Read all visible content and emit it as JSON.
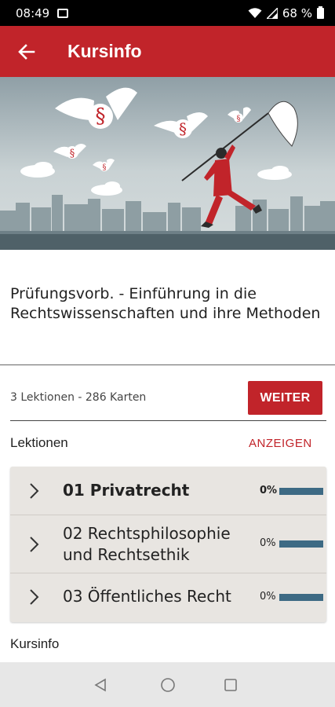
{
  "status_bar": {
    "time": "08:49",
    "battery": "68 %"
  },
  "app_bar": {
    "title": "Kursinfo",
    "back_icon": "arrow-back-icon"
  },
  "course": {
    "title": "Prüfungsvorb. - Einführung in die Rechtswissenschaften und ihre Methoden",
    "meta": "3 Lektionen - 286 Karten",
    "continue_label": "WEITER"
  },
  "lessons_section": {
    "label": "Lektionen",
    "show_label": "ANZEIGEN",
    "items": [
      {
        "name": "01 Privatrecht",
        "progress_label": "0%",
        "progress": 0,
        "bold": true
      },
      {
        "name": "02 Rechtsphilosophie und Rechtsethik",
        "progress_label": "0%",
        "progress": 0,
        "bold": false
      },
      {
        "name": "03 Öffentliches Recht",
        "progress_label": "0%",
        "progress": 0,
        "bold": false
      }
    ]
  },
  "kursinfo_section": {
    "label": "Kursinfo"
  },
  "colors": {
    "brand_red": "#c1242a",
    "progress_bar": "#3d6a84",
    "list_background": "#e8e5e1"
  },
  "nav_bar": {
    "back": "nav-back-icon",
    "home": "nav-home-icon",
    "recents": "nav-recents-icon"
  }
}
